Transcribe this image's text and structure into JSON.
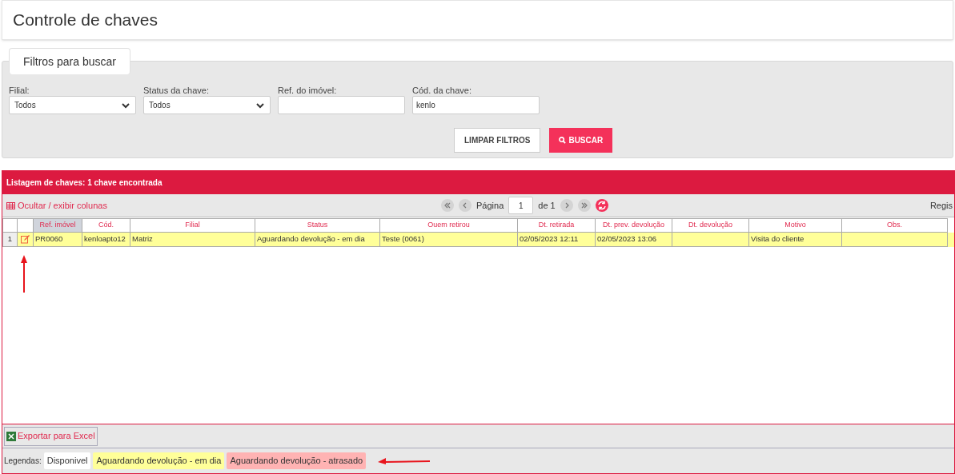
{
  "page_title": "Controle de chaves",
  "filters": {
    "tab": "Filtros para buscar",
    "fields": [
      {
        "kind": "select",
        "label": "Filial:",
        "value": "Todos"
      },
      {
        "kind": "select",
        "label": "Status da chave:",
        "value": "Todos"
      },
      {
        "kind": "text",
        "label": "Ref. do imóvel:"
      },
      {
        "kind": "text",
        "label": "Cód. da chave:",
        "value": "kenlo"
      }
    ],
    "buttons": [
      {
        "kind": "secondary",
        "label": "LIMPAR FILTROS"
      },
      {
        "kind": "primary",
        "label": "BUSCAR"
      }
    ]
  },
  "listing": {
    "title": "Listagem de chaves: 1 chave encontrada",
    "toggle_columns": "Ocultar / exibir colunas",
    "pager": {
      "label": "Página",
      "page": "1",
      "of": "de 1"
    },
    "records_label": "Regis",
    "columns": [
      {
        "label": "Ref. imóvel",
        "sorted": true
      },
      {
        "label": "Cód.",
        "sorted": false
      },
      {
        "label": "Filial",
        "sorted": false
      },
      {
        "label": "Status",
        "sorted": false
      },
      {
        "label": "Ouem retirou",
        "sorted": false
      },
      {
        "label": "Dt. retirada",
        "sorted": false
      },
      {
        "label": "Dt. prev. devolução",
        "sorted": false
      },
      {
        "label": "Dt. devolução",
        "sorted": false
      },
      {
        "label": "Motivo",
        "sorted": false
      },
      {
        "label": "Obs.",
        "sorted": false
      }
    ],
    "rows": [
      {
        "number": "1",
        "color": "#ffff99",
        "cells": [
          "PR0060",
          "kenloapto12",
          "Matriz",
          "Aguardando devolução - em dia",
          "Teste (0061)",
          "02/05/2023 12:11",
          "02/05/2023 13:06",
          "",
          "Visita do cliente",
          ""
        ]
      }
    ],
    "export": "Exportar para Excel",
    "legend": {
      "label": "Legendas:",
      "items": [
        {
          "text": "Disponivel",
          "color": "#ffffff"
        },
        {
          "text": "Aguardando devolução - em dia",
          "color": "#ffff99"
        },
        {
          "text": "Aguardando devolução - atrasado",
          "color": "#ffb3b3"
        }
      ]
    }
  }
}
